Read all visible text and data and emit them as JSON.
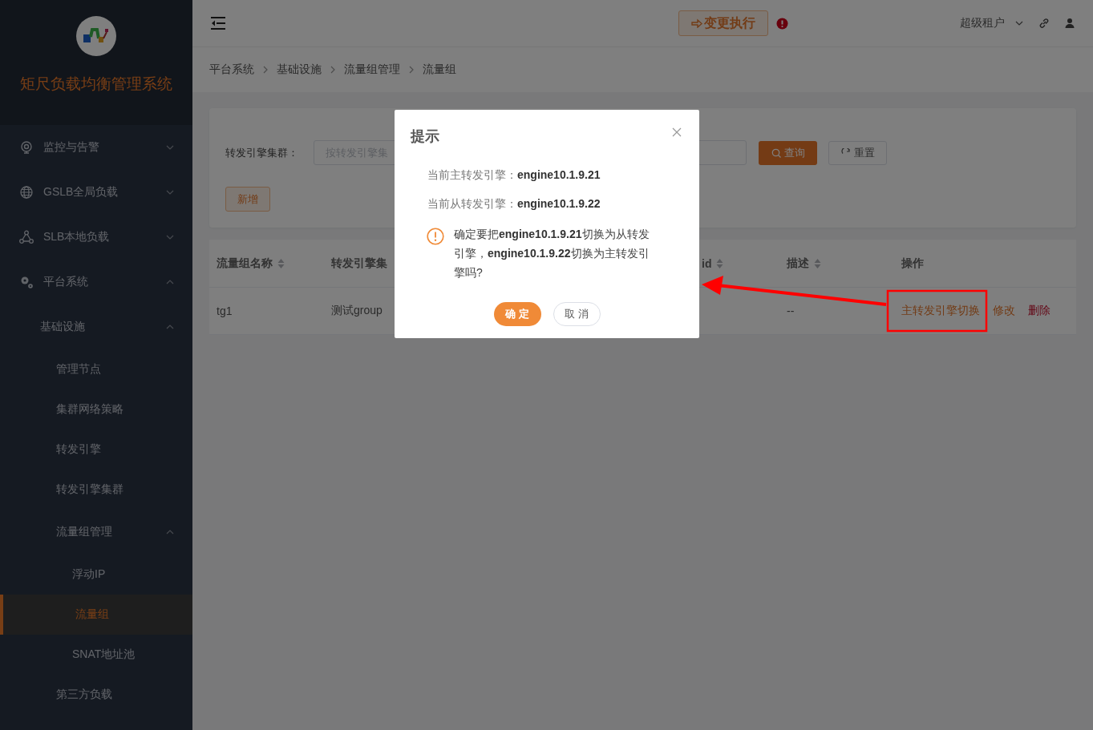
{
  "app": {
    "title": "矩尺负载均衡管理系统"
  },
  "sidebar": {
    "items": [
      {
        "label": "监控与告警",
        "expanded": false,
        "selected": false
      },
      {
        "label": "GSLB全局负载",
        "expanded": false,
        "selected": false
      },
      {
        "label": "SLB本地负载",
        "expanded": false,
        "selected": false
      },
      {
        "label": "平台系统",
        "expanded": true,
        "selected": false,
        "children": [
          {
            "label": "基础设施",
            "expanded": true,
            "selected": false,
            "children": [
              {
                "label": "管理节点",
                "selected": false
              },
              {
                "label": "集群网络策略",
                "selected": false
              },
              {
                "label": "转发引擎",
                "selected": false
              },
              {
                "label": "转发引擎集群",
                "selected": false
              },
              {
                "label": "流量组管理",
                "expanded": true,
                "selected": false,
                "children": [
                  {
                    "label": "浮动IP",
                    "selected": false
                  },
                  {
                    "label": "流量组",
                    "selected": true
                  },
                  {
                    "label": "SNAT地址池",
                    "selected": false
                  }
                ]
              },
              {
                "label": "第三方负载",
                "selected": false
              }
            ]
          }
        ]
      }
    ]
  },
  "header": {
    "change_button": "变更执行",
    "tenant": "超级租户"
  },
  "breadcrumb": [
    "平台系统",
    "基础设施",
    "流量组管理",
    "流量组"
  ],
  "filter": {
    "label": "转发引擎集群：",
    "placeholder": "按转发引擎集",
    "query_button": "查询",
    "reset_button": "重置",
    "add_button": "新增"
  },
  "table": {
    "columns": [
      {
        "label": "流量组名称",
        "sortable": true
      },
      {
        "label": "转发引擎集",
        "sortable": false
      },
      {
        "label": "id",
        "sortable": true
      },
      {
        "label": "描述",
        "sortable": true
      },
      {
        "label": "操作",
        "sortable": false
      }
    ],
    "rows": [
      {
        "name": "tg1",
        "cluster": "测试group",
        "description": "--",
        "actions": [
          {
            "label": "主转发引擎切换",
            "kind": "primary"
          },
          {
            "label": "修改",
            "kind": "primary"
          },
          {
            "label": "删除",
            "kind": "danger"
          }
        ]
      }
    ]
  },
  "dialog": {
    "title": "提示",
    "lines": [
      {
        "label": "当前主转发引擎：",
        "value": "engine10.1.9.21"
      },
      {
        "label": "当前从转发引擎：",
        "value": "engine10.1.9.22"
      }
    ],
    "message": "确定要把**engine10.1.9.21**切换为从转发引擎，**engine10.1.9.22**切换为主转发引擎吗?",
    "buttons": [
      {
        "label": "确 定",
        "kind": "primary"
      },
      {
        "label": "取 消",
        "kind": "default"
      }
    ]
  }
}
